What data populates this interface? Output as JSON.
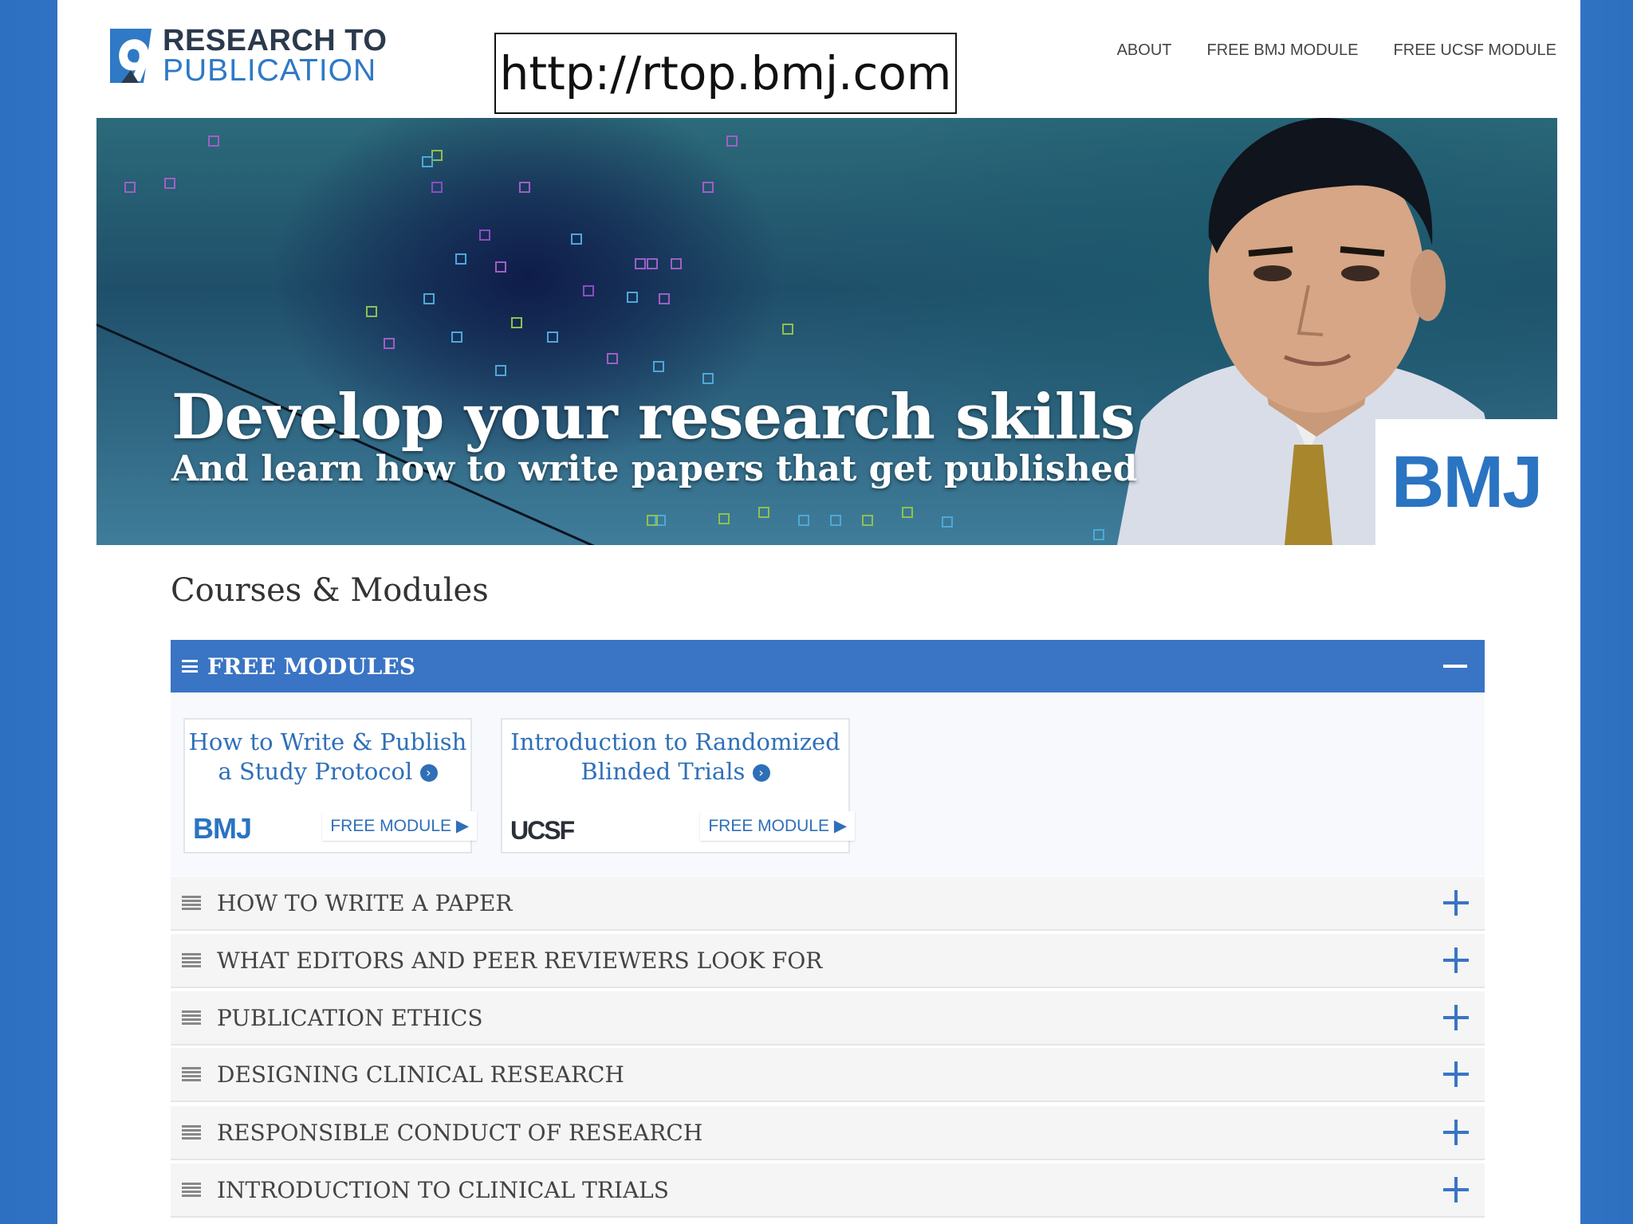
{
  "header": {
    "logo_line1": "RESEARCH TO",
    "logo_line2": "PUBLICATION",
    "url": "http://rtop.bmj.com",
    "nav": [
      "ABOUT",
      "FREE BMJ MODULE",
      "FREE UCSF MODULE"
    ]
  },
  "hero": {
    "title": "Develop your research skills",
    "subtitle": "And learn how to write papers that get published",
    "brand": "BMJ"
  },
  "section_title": "Courses & Modules",
  "free_modules": {
    "label": "FREE MODULES",
    "cards": [
      {
        "title_line1": "How to Write & Publish",
        "title_line2": "a Study Protocol",
        "logo": "BMJ",
        "link": "FREE MODULE ▶"
      },
      {
        "title_line1": "Introduction to Randomized",
        "title_line2": "Blinded Trials",
        "logo": "UCSF",
        "link": "FREE MODULE ▶"
      }
    ]
  },
  "accordion": [
    "HOW TO WRITE A PAPER",
    "WHAT EDITORS AND PEER REVIEWERS LOOK FOR",
    "PUBLICATION ETHICS",
    "DESIGNING CLINICAL RESEARCH",
    "RESPONSIBLE CONDUCT OF RESEARCH",
    "INTRODUCTION TO CLINICAL TRIALS"
  ],
  "colors": {
    "accent": "#3a74c4",
    "brand_blue": "#2a74c2"
  }
}
